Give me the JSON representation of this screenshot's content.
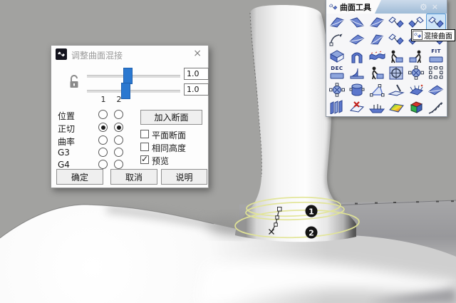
{
  "dialog": {
    "title": "调整曲面混接",
    "close_icon": "×",
    "slider1_value": "1.0",
    "slider2_value": "1.0",
    "col1": "1",
    "col2": "2",
    "rows": [
      {
        "label": "位置",
        "c1": false,
        "c2": false
      },
      {
        "label": "正切",
        "c1": true,
        "c2": true
      },
      {
        "label": "曲率",
        "c1": false,
        "c2": false
      },
      {
        "label": "G3",
        "c1": false,
        "c2": false
      },
      {
        "label": "G4",
        "c1": false,
        "c2": false
      }
    ],
    "add_section": "加入断面",
    "checks": [
      {
        "label": "平面断面",
        "checked": false
      },
      {
        "label": "相同高度",
        "checked": false
      },
      {
        "label": "预览",
        "checked": true
      }
    ],
    "ok": "确定",
    "cancel": "取消",
    "help": "说明"
  },
  "palette": {
    "title": "曲面工具",
    "gear_icon": "⚙",
    "close_icon": "×",
    "tooltip": "混接曲面",
    "fit_label": "FIT",
    "dec_label": "DEC"
  },
  "viewport": {
    "marker1": "1",
    "marker2": "2",
    "colors": {
      "background": "#a2a2a0",
      "blend_curve": "#e2e596",
      "marker_bg": "#141414",
      "slider_accent": "#2b78d0"
    }
  }
}
